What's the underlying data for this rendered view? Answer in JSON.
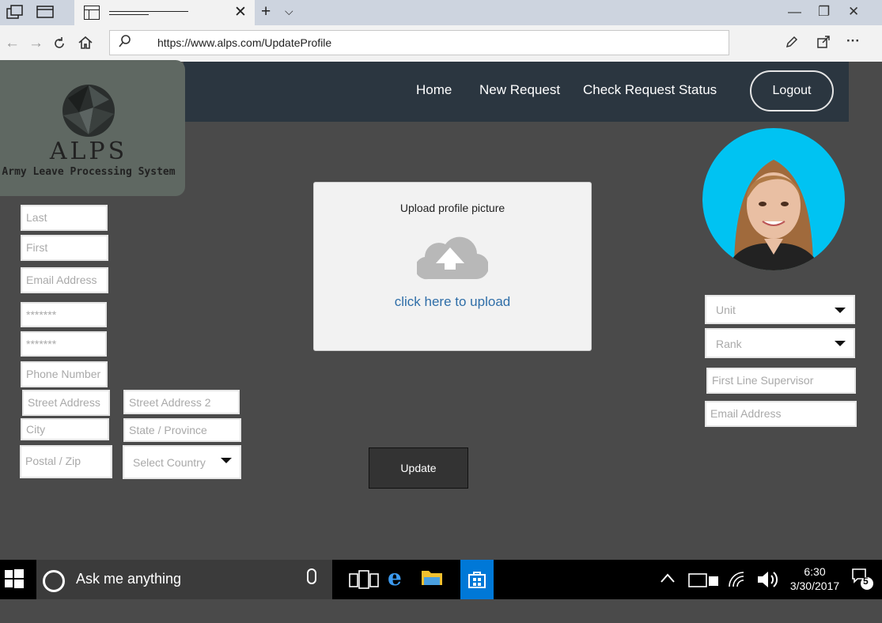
{
  "browser": {
    "url": "https://www.alps.com/UpdateProfile",
    "tab_close": "✕",
    "new_tab": "+",
    "tab_menu": "⌵",
    "window_controls": [
      "—",
      "❐",
      "✕"
    ]
  },
  "site": {
    "logo_title": "ALPS",
    "logo_subtitle": "Army Leave Processing System",
    "nav": {
      "home": "Home",
      "new_request": "New Request",
      "check_status": "Check Request Status"
    },
    "logout": "Logout"
  },
  "form": {
    "last": "Last",
    "first": "First",
    "email": "Email Address",
    "password": "*******",
    "password_confirm": "*******",
    "phone": "Phone Number",
    "street": "Street Address",
    "street2": "Street Address 2",
    "city": "City",
    "state": "State / Province",
    "postal": "Postal / Zip",
    "country": "Select Country",
    "unit": "Unit",
    "rank": "Rank",
    "supervisor": "First Line Supervisor",
    "supervisor_email": "Email Address"
  },
  "upload": {
    "title": "Upload profile picture",
    "link": "click here to upload"
  },
  "update_button": "Update",
  "taskbar": {
    "search": "Ask me anything",
    "time": "6:30",
    "date": "3/30/2017",
    "notifications": "5"
  },
  "colors": {
    "header": "#2b3640",
    "avatar_bg": "#00c3f2",
    "upload_link": "#2f6ea8"
  }
}
